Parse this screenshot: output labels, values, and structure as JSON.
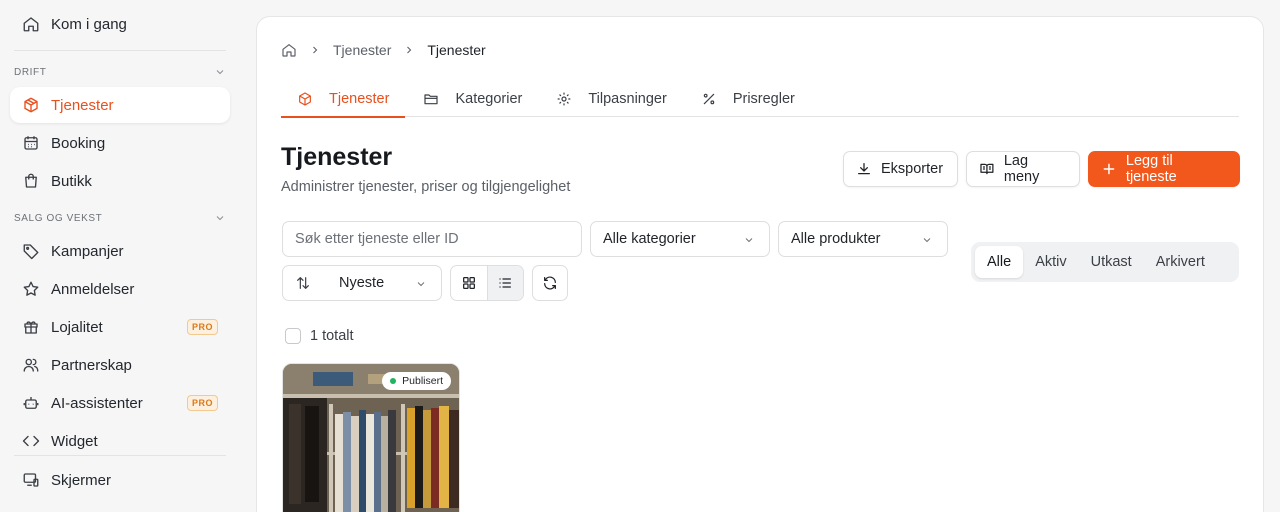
{
  "sidebar": {
    "top_item": "Kom i gang",
    "sections": [
      {
        "label": "DRIFT"
      },
      {
        "label": "SALG OG VEKST"
      }
    ],
    "items": {
      "tjenester": "Tjenester",
      "booking": "Booking",
      "butikk": "Butikk",
      "kampanjer": "Kampanjer",
      "anmeldelser": "Anmeldelser",
      "lojalitet": "Lojalitet",
      "partnerskap": "Partnerskap",
      "ai": "AI-assistenter",
      "widget": "Widget",
      "skjermer": "Skjermer"
    },
    "pro_label": "PRO"
  },
  "breadcrumb": {
    "level1": "Tjenester",
    "level2": "Tjenester"
  },
  "tabs": [
    "Tjenester",
    "Kategorier",
    "Tilpasninger",
    "Prisregler"
  ],
  "page": {
    "title": "Tjenester",
    "subtitle": "Administrer tjenester, priser og tilgjengelighet"
  },
  "actions": {
    "export": "Eksporter",
    "menu": "Lag meny",
    "add": "Legg til tjeneste"
  },
  "filters": {
    "search_placeholder": "Søk etter tjeneste eller ID",
    "category": "Alle kategorier",
    "product": "Alle produkter",
    "sort": "Nyeste"
  },
  "status_tabs": [
    "Alle",
    "Aktiv",
    "Utkast",
    "Arkivert"
  ],
  "list": {
    "total": "1 totalt",
    "items": [
      {
        "status": "Publisert"
      }
    ]
  },
  "colors": {
    "accent": "#f2581c",
    "published": "#22b35e"
  }
}
